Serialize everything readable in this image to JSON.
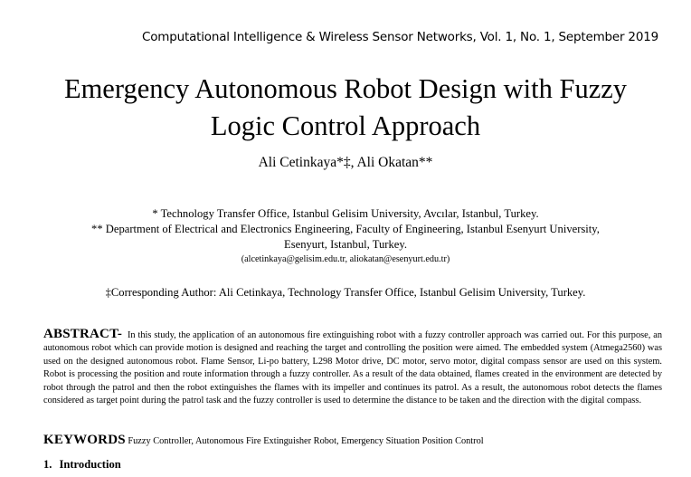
{
  "header": {
    "journal": "Computational Intelligence & Wireless Sensor Networks, Vol. 1, No. 1, September 2019"
  },
  "title": {
    "line1": "Emergency Autonomous Robot Design with Fuzzy",
    "line2": "Logic Control Approach"
  },
  "authors": "Ali Cetinkaya*‡, Ali Okatan**",
  "affiliations": {
    "line1": "* Technology Transfer Office, Istanbul Gelisim University, Avcılar, Istanbul, Turkey.",
    "line2": "** Department of Electrical and Electronics Engineering, Faculty of Engineering, Istanbul Esenyurt University,",
    "line3": "Esenyurt, Istanbul, Turkey.",
    "emails": "(alcetinkaya@gelisim.edu.tr, aliokatan@esenyurt.edu.tr)"
  },
  "corresponding": "‡Corresponding Author: Ali Cetinkaya, Technology Transfer Office, Istanbul Gelisim University, Turkey.",
  "abstract": {
    "label": "ABSTRACT-",
    "text": "In this study, the application of an autonomous fire extinguishing robot with a fuzzy controller approach was carried out. For this purpose, an autonomous robot which can provide motion is designed and reaching the target and controlling the position were aimed. The embedded system (Atmega2560) was used on the designed autonomous robot. Flame Sensor, Li-po battery, L298 Motor drive, DC motor, servo motor, digital compass sensor are used on this system. Robot is processing the position and route information through a fuzzy controller. As a result of the data obtained, flames created in the environment are detected by robot through the patrol and then the robot extinguishes the flames with its impeller and continues its patrol. As a result, the autonomous robot detects the flames considered as target point during the patrol task and the fuzzy controller is used to determine the distance to be taken and the direction with the digital compass."
  },
  "keywords": {
    "label": "KEYWORDS",
    "text": "Fuzzy Controller, Autonomous Fire Extinguisher Robot, Emergency Situation Position Control"
  },
  "section": {
    "number": "1.",
    "title": "Introduction"
  }
}
